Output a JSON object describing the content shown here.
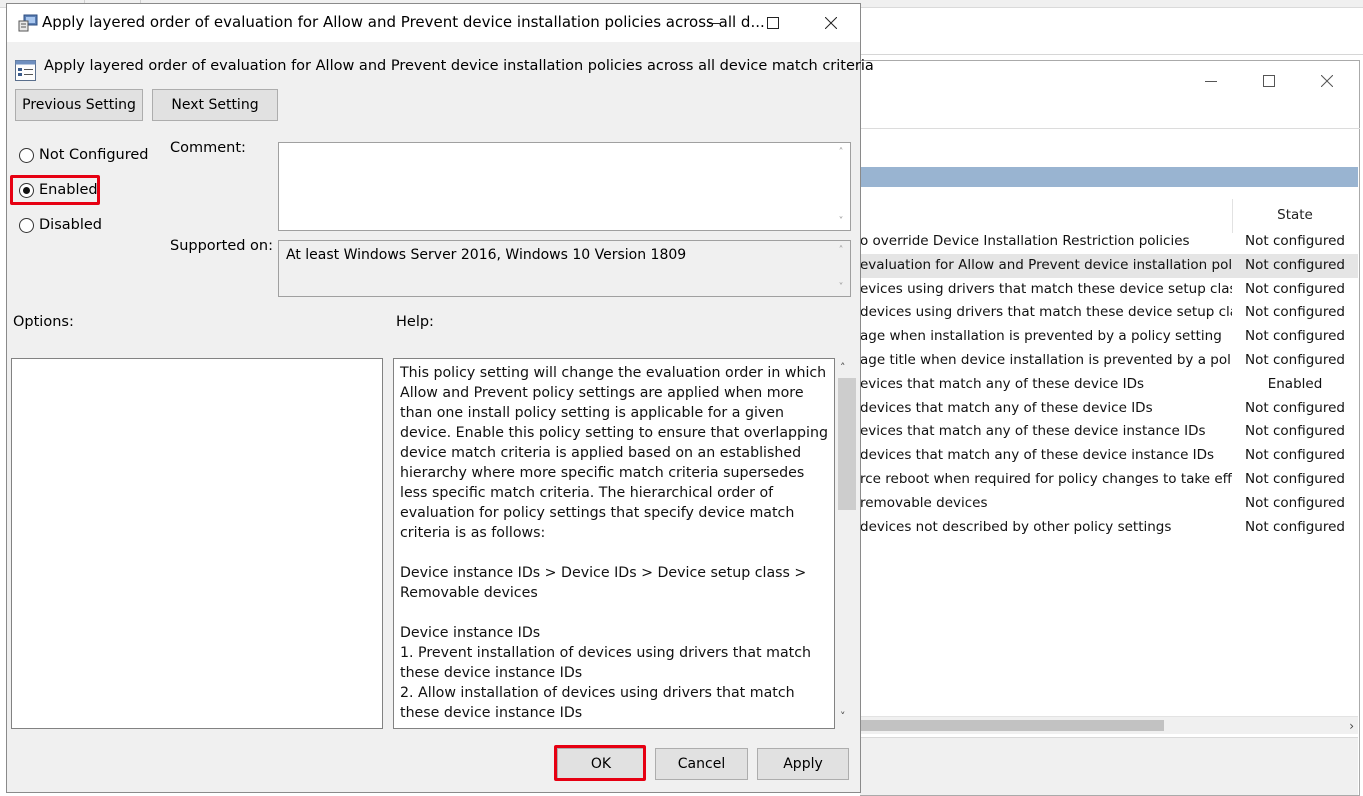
{
  "background_window": {
    "state_header": "State",
    "rows": [
      {
        "name": "o override Device Installation Restriction policies",
        "state": "Not configured"
      },
      {
        "name": "evaluation for Allow and Prevent device installation pol...",
        "state": "Not configured",
        "selected": true
      },
      {
        "name": "evices using drivers that match these device setup classes",
        "state": "Not configured"
      },
      {
        "name": "devices using drivers that match these device setup clas...",
        "state": "Not configured"
      },
      {
        "name": "age when installation is prevented by a policy setting",
        "state": "Not configured"
      },
      {
        "name": "age title when device installation is prevented by a poli...",
        "state": "Not configured"
      },
      {
        "name": "evices that match any of these device IDs",
        "state": "Enabled"
      },
      {
        "name": "devices that match any of these device IDs",
        "state": "Not configured"
      },
      {
        "name": "evices that match any of these device instance IDs",
        "state": "Not configured"
      },
      {
        "name": "devices that match any of these device instance IDs",
        "state": "Not configured"
      },
      {
        "name": "rce reboot when required for policy changes to take eff...",
        "state": "Not configured"
      },
      {
        "name": "removable devices",
        "state": "Not configured"
      },
      {
        "name": "devices not described by other policy settings",
        "state": "Not configured"
      }
    ]
  },
  "dialog": {
    "title": "Apply layered order of evaluation for Allow and Prevent device installation policies across all d...",
    "setting_name": "Apply layered order of evaluation for Allow and Prevent device installation policies across all device match criteria",
    "prev_button": "Previous Setting",
    "next_button": "Next Setting",
    "radios": {
      "not_configured": "Not Configured",
      "enabled": "Enabled",
      "disabled": "Disabled",
      "selected": "enabled"
    },
    "comment_label": "Comment:",
    "comment_value": "",
    "supported_label": "Supported on:",
    "supported_value": "At least Windows Server 2016, Windows 10 Version 1809",
    "options_label": "Options:",
    "help_label": "Help:",
    "help_text": "This policy setting will change the evaluation order in which Allow and Prevent policy settings are applied when more than one install policy setting is applicable for a given device. Enable this policy setting to ensure that overlapping device match criteria is applied based on an established hierarchy where more specific match criteria supersedes less specific match criteria. The hierarchical order of evaluation for policy settings that specify device match criteria is as follows:\n\nDevice instance IDs > Device IDs > Device setup class > Removable devices\n\nDevice instance IDs\n1. Prevent installation of devices using drivers that match these device instance IDs\n2. Allow installation of devices using drivers that match these device instance IDs\n\nDevice IDs",
    "ok_button": "OK",
    "cancel_button": "Cancel",
    "apply_button": "Apply"
  },
  "colors": {
    "highlight_box": "#e60012",
    "header_band": "#99b4d1",
    "dialog_bg": "#f0f0f0"
  },
  "icons": [
    "policy-app-icon",
    "policy-setting-icon",
    "minimize-icon",
    "maximize-icon",
    "close-icon",
    "scroll-up-icon",
    "scroll-down-icon",
    "scroll-right-icon"
  ]
}
